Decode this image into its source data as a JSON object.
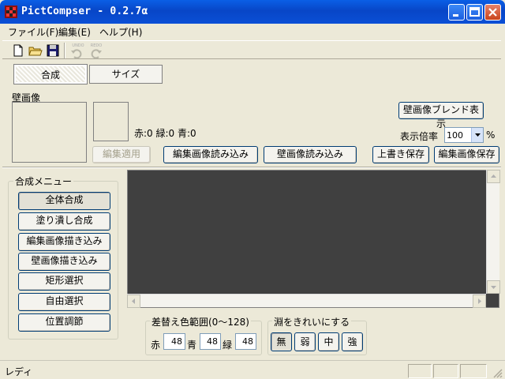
{
  "window": {
    "title": "PictCompser - 0.2.7α"
  },
  "menu": {
    "file": "ファイル(F)",
    "edit": "編集(E)",
    "help": "ヘルプ(H)"
  },
  "toolbar": {
    "undo": "UNDO",
    "redo": "REDO"
  },
  "tabs": [
    {
      "label": "合成",
      "active": true
    },
    {
      "label": "サイズ",
      "active": false
    }
  ],
  "wallpaper": {
    "label": "壁画像",
    "color_readout": "赤:0 緑:0 青:0",
    "blend_button": "壁画像ブレンド表示",
    "zoom_label": "表示倍率",
    "zoom_value": "100",
    "zoom_unit": "%",
    "buttons": {
      "apply_edit": "編集適用",
      "load_edit": "編集画像読み込み",
      "load_wall": "壁画像読み込み",
      "overwrite_save": "上書き保存",
      "save_edit": "編集画像保存"
    }
  },
  "compose_menu": {
    "title": "合成メニュー",
    "items": [
      "全体合成",
      "塗り潰し合成",
      "編集画像描き込み",
      "壁画像描き込み",
      "矩形選択",
      "自由選択",
      "位置調節"
    ]
  },
  "color_range": {
    "title": "差替え色範囲(0〜128)",
    "red_label": "赤",
    "red_value": "48",
    "blue_label": "青",
    "blue_value": "48",
    "green_label": "緑",
    "green_value": "48"
  },
  "edge": {
    "title": "淵をきれいにする",
    "options": [
      "無",
      "弱",
      "中",
      "強"
    ]
  },
  "status": {
    "text": "レディ"
  }
}
